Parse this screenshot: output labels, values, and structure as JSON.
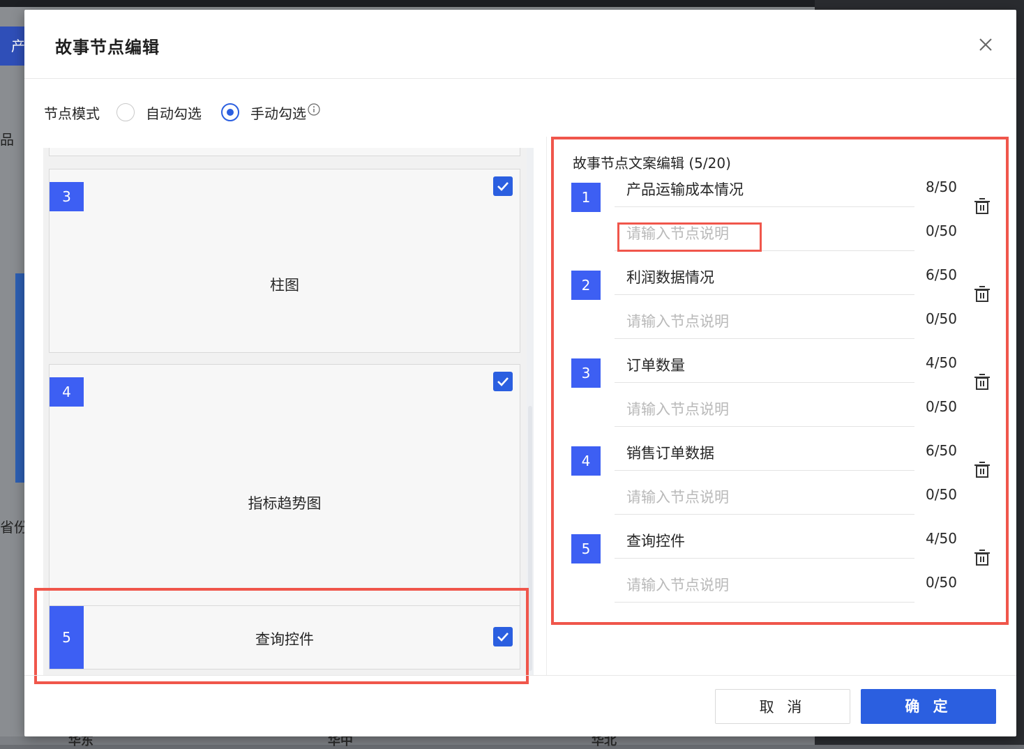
{
  "background": {
    "tab_label": "产",
    "side_texts": [
      "品",
      "省份"
    ],
    "bottom_labels": [
      "华东",
      "华中",
      "华北"
    ]
  },
  "modal": {
    "title": "故事节点编辑",
    "close_icon": "close-icon"
  },
  "mode": {
    "label": "节点模式",
    "options": [
      {
        "label": "自动勾选",
        "checked": false
      },
      {
        "label": "手动勾选",
        "checked": true
      }
    ],
    "info_icon": "info-icon"
  },
  "left_list": {
    "cards": [
      {
        "num": "3",
        "title": "柱图",
        "checked": true
      },
      {
        "num": "4",
        "title": "指标趋势图",
        "checked": true
      },
      {
        "num": "5",
        "title": "查询控件",
        "checked": true
      }
    ]
  },
  "right_panel": {
    "title": "故事节点文案编辑 (5/20)",
    "nodes": [
      {
        "num": "1",
        "name": "产品运输成本情况",
        "name_count": "8/50",
        "desc_placeholder": "请输入节点说明",
        "desc_count": "0/50"
      },
      {
        "num": "2",
        "name": "利润数据情况",
        "name_count": "6/50",
        "desc_placeholder": "请输入节点说明",
        "desc_count": "0/50"
      },
      {
        "num": "3",
        "name": "订单数量",
        "name_count": "4/50",
        "desc_placeholder": "请输入节点说明",
        "desc_count": "0/50"
      },
      {
        "num": "4",
        "name": "销售订单数据",
        "name_count": "6/50",
        "desc_placeholder": "请输入节点说明",
        "desc_count": "0/50"
      },
      {
        "num": "5",
        "name": "查询控件",
        "name_count": "4/50",
        "desc_placeholder": "请输入节点说明",
        "desc_count": "0/50"
      }
    ]
  },
  "footer": {
    "cancel_label": "取 消",
    "ok_label": "确 定"
  },
  "colors": {
    "accent": "#2b5fe0",
    "badge": "#3d5ff3",
    "highlight": "#f0564b"
  }
}
